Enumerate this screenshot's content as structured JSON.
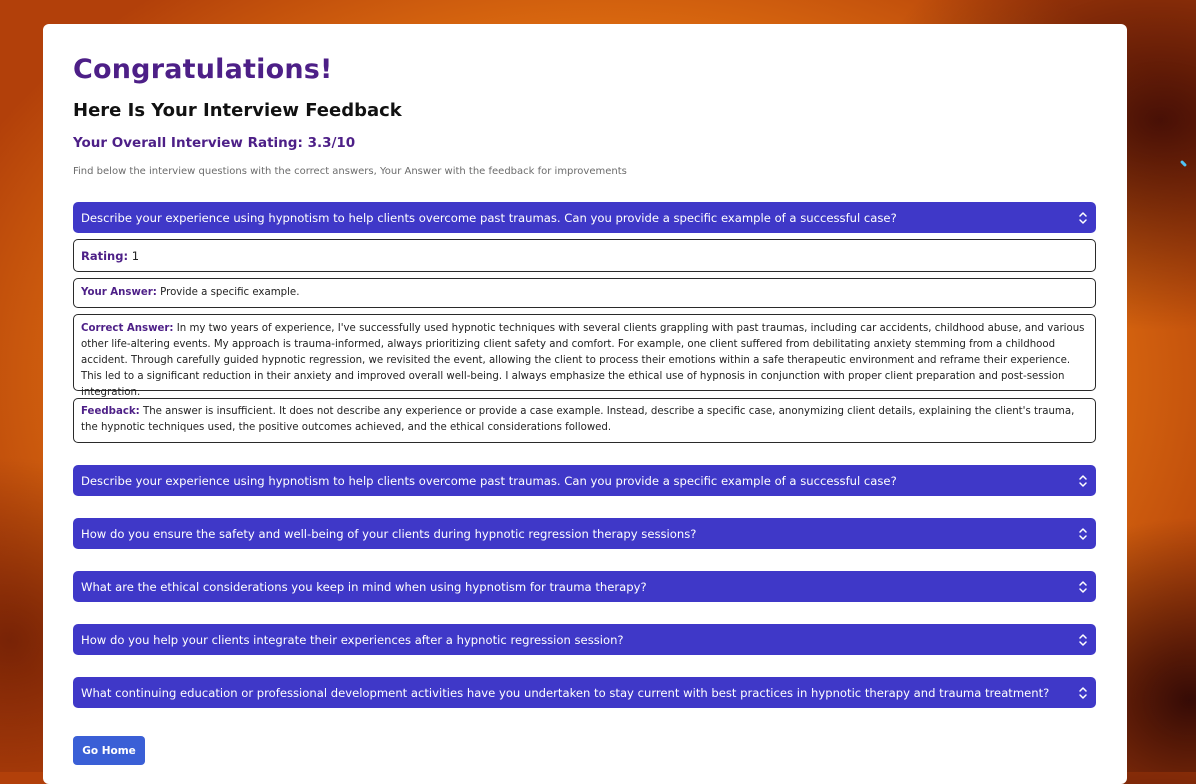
{
  "page": {
    "title": "Congratulations!",
    "subtitle": "Here Is Your Interview Feedback",
    "rating_label": "Your Overall Interview Rating:",
    "rating_value": "3.3/10",
    "intro": "Find below the interview questions with the correct answers, Your Answer with the feedback for improvements"
  },
  "expanded": {
    "question": "Describe your experience using hypnotism to help clients overcome past traumas. Can you provide a specific example of a successful case?",
    "rating_label": "Rating:",
    "rating_value": "1",
    "answer_label": "Your Answer:",
    "answer_text": "Provide a specific example.",
    "correct_label": "Correct Answer:",
    "correct_text": "In my two years of experience, I've successfully used hypnotic techniques with several clients grappling with past traumas, including car accidents, childhood abuse, and various other life-altering events. My approach is trauma-informed, always prioritizing client safety and comfort. For example, one client suffered from debilitating anxiety stemming from a childhood accident. Through carefully guided hypnotic regression, we revisited the event, allowing the client to process their emotions within a safe therapeutic environment and reframe their experience. This led to a significant reduction in their anxiety and improved overall well-being. I always emphasize the ethical use of hypnosis in conjunction with proper client preparation and post-session integration.",
    "feedback_label": "Feedback:",
    "feedback_text": "The answer is insufficient. It does not describe any experience or provide a case example. Instead, describe a specific case, anonymizing client details, explaining the client's trauma, the hypnotic techniques used, the positive outcomes achieved, and the ethical considerations followed."
  },
  "questions": [
    "Describe your experience using hypnotism to help clients overcome past traumas. Can you provide a specific example of a successful case?",
    "How do you ensure the safety and well-being of your clients during hypnotic regression therapy sessions?",
    "What are the ethical considerations you keep in mind when using hypnotism for trauma therapy?",
    "How do you help your clients integrate their experiences after a hypnotic regression session?",
    "What continuing education or professional development activities have you undertaken to stay current with best practices in hypnotic therapy and trauma treatment?"
  ],
  "go_home_label": "Go Home",
  "icons": {
    "accordion_toggle": "chevron-up-down-icon"
  },
  "colors": {
    "accent": "#3f38c8",
    "heading": "#4d1f87",
    "button": "#3a5fd6"
  }
}
